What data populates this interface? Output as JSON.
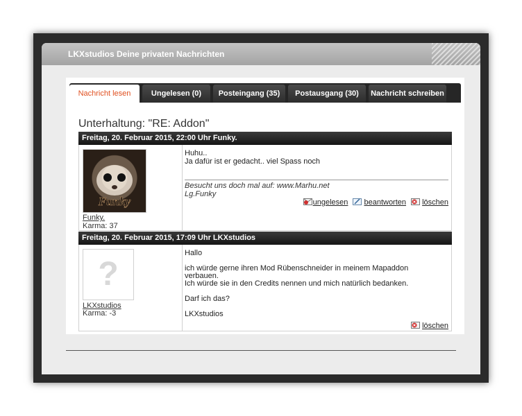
{
  "window": {
    "title": "LKXstudios Deine privaten Nachrichten"
  },
  "tabs": [
    {
      "label": "Nachricht lesen",
      "active": true
    },
    {
      "label": "Ungelesen (0)",
      "active": false
    },
    {
      "label": "Posteingang (35)",
      "active": false
    },
    {
      "label": "Postausgang (30)",
      "active": false
    },
    {
      "label": "Nachricht schreiben",
      "active": false
    }
  ],
  "conversation": {
    "title": "Unterhaltung: \"RE: Addon\""
  },
  "messages": [
    {
      "header": "Freitag, 20. Februar 2015, 22:00 Uhr Funky.",
      "author": {
        "name": "Funky.",
        "karma": "Karma: 37",
        "avatar_text": "Funky"
      },
      "body": [
        "Huhu..",
        "Ja dafür ist er gedacht.. viel Spass noch"
      ],
      "signature": [
        "Besucht uns doch mal auf: www.Marhu.net",
        "Lg.Funky"
      ],
      "actions": {
        "unread": "ungelesen",
        "reply": "beantworten",
        "delete": "löschen"
      }
    },
    {
      "header": "Freitag, 20. Februar 2015, 17:09 Uhr LKXstudios",
      "author": {
        "name": "LKXstudios",
        "karma": "Karma: -3",
        "avatar_text": "?"
      },
      "body": [
        "Hallo",
        "ich würde gerne ihren Mod Rübenschneider in meinem Mapaddon",
        "verbauen.",
        "Ich würde sie in den Credits nennen und mich natürlich bedanken.",
        "Darf ich das?",
        "LKXstudios"
      ],
      "actions": {
        "delete": "löschen"
      }
    }
  ],
  "colors": {
    "active_tab_text": "#e05020",
    "title_bar": "#b4b4b4",
    "frame": "#2b2b2b"
  }
}
